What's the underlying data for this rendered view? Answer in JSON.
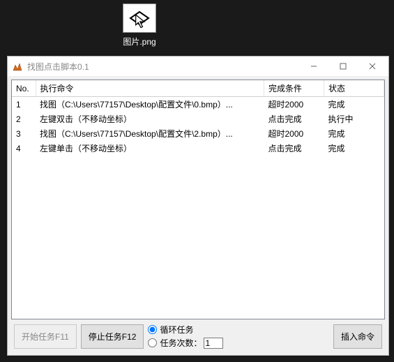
{
  "desktop": {
    "file_label": "图片.png"
  },
  "window": {
    "title": "找图点击脚本0.1",
    "columns": {
      "no": "No.",
      "cmd": "执行命令",
      "cond": "完成条件",
      "status": "状态"
    },
    "rows": [
      {
        "no": "1",
        "cmd": "找图（C:\\Users\\77157\\Desktop\\配置文件\\0.bmp）...",
        "cond": "超时2000",
        "status": "完成"
      },
      {
        "no": "2",
        "cmd": "左键双击（不移动坐标）",
        "cond": "点击完成",
        "status": "执行中"
      },
      {
        "no": "3",
        "cmd": "找图（C:\\Users\\77157\\Desktop\\配置文件\\2.bmp）...",
        "cond": "超时2000",
        "status": "完成"
      },
      {
        "no": "4",
        "cmd": "左键单击（不移动坐标）",
        "cond": "点击完成",
        "status": "完成"
      }
    ],
    "footer": {
      "start_label": "开始任务F11",
      "stop_label": "停止任务F12",
      "loop_label": "循环任务",
      "count_label": "任务次数：",
      "count_value": "1",
      "insert_label": "插入命令",
      "mode_selected": "loop"
    }
  }
}
